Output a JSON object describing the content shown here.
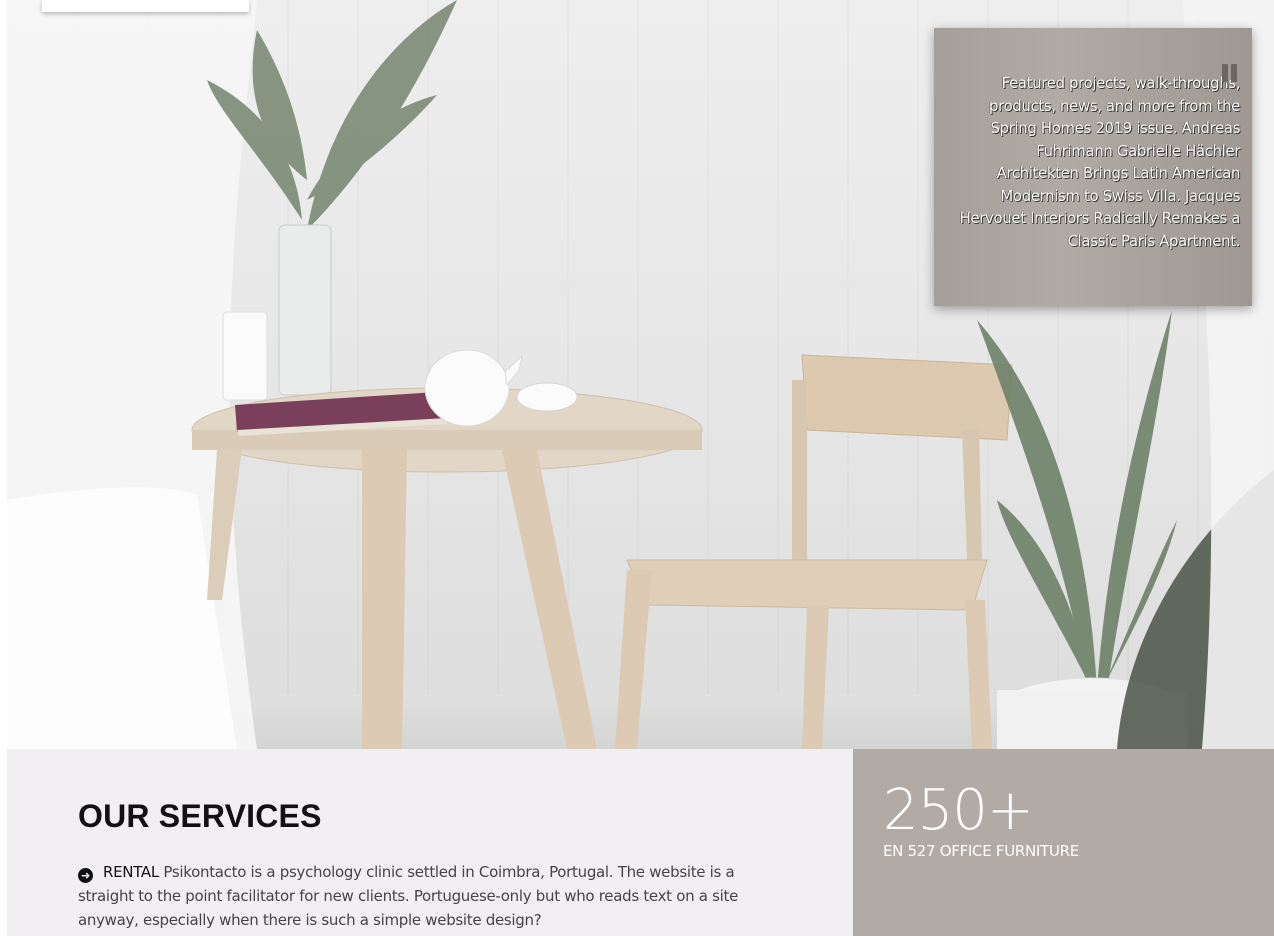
{
  "hero": {
    "caption": "Featured projects, walk-throughs, products, news, and more from the Spring Homes 2019 issue. Andreas Fuhrimann Gabrielle Hächler Architekten Brings Latin American Modernism to Swiss Villa. Jacques Hervouet Interiors Radically Remakes a Classic Paris Apartment.",
    "pause_icon": "pause-icon"
  },
  "services": {
    "title": "OUR SERVICES",
    "bullet_icon": "arrow-circle-right-icon",
    "item_label": "RENTAL",
    "item_text": "Psikontacto is a psychology clinic settled in Coimbra, Portugal. The website is a straight to the point facilitator for new clients. Portuguese-only but who reads text on a site anyway, especially when there is such a simple website design?"
  },
  "stats": {
    "number": "250+",
    "label": "EN 527 OFFICE FURNITURE"
  },
  "colors": {
    "services_bg": "#f1eff2",
    "stats_bg": "#b2aaa5",
    "caption_bg": "#a59f99"
  }
}
